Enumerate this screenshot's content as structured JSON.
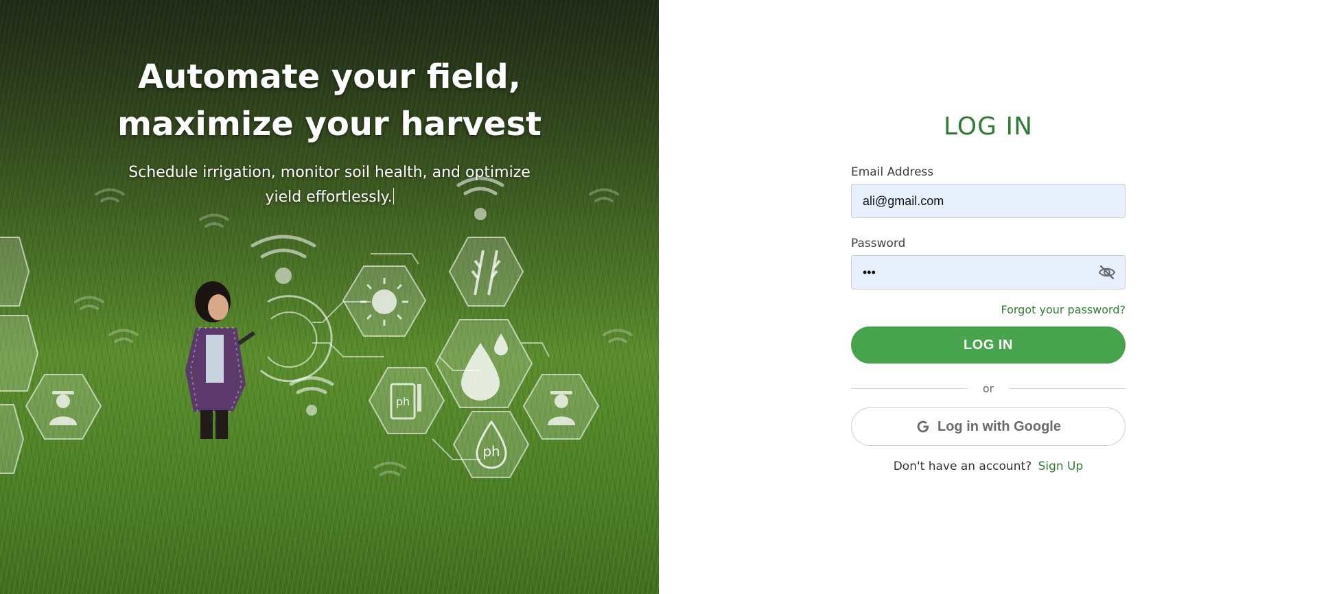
{
  "hero": {
    "title_line1": "Automate your field,",
    "title_line2": "maximize your harvest",
    "subtitle": "Schedule irrigation, monitor soil health, and optimize yield effortlessly.",
    "icon_labels": {
      "ph_pen": "ph",
      "ph_drop": "ph"
    }
  },
  "login": {
    "title": "LOG IN",
    "email_label": "Email Address",
    "email_value": "ali@gmail.com",
    "password_label": "Password",
    "password_value": "abc",
    "forgot_label": "Forgot your password?",
    "login_button": "LOG IN",
    "divider_text": "or",
    "google_button": "Log in with Google",
    "signup_prompt": "Don't have an account?",
    "signup_link": "Sign Up"
  },
  "icons": {
    "password_toggle": "eye-slash-icon",
    "google": "google-g-icon"
  },
  "colors": {
    "brand_green": "#2f7d32",
    "button_green": "#48a34d",
    "input_fill": "#e8f0fe"
  }
}
